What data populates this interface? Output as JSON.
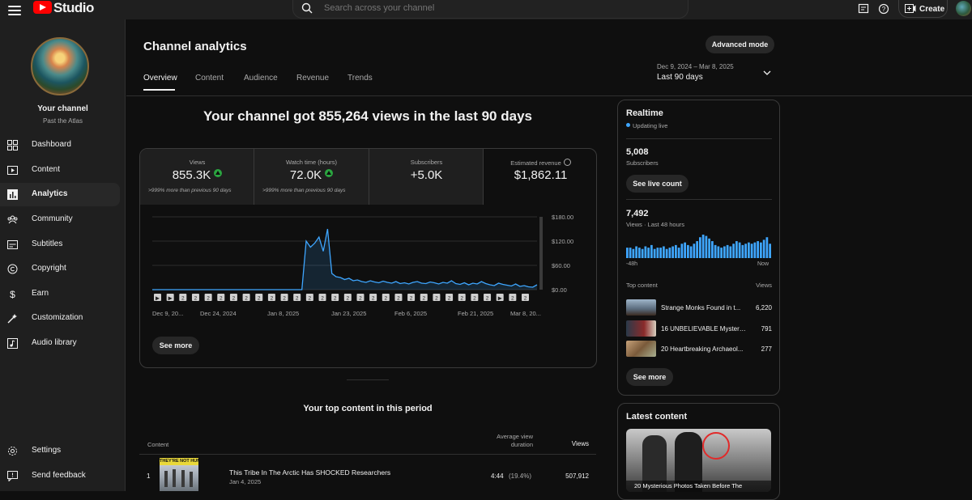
{
  "header": {
    "logo_text": "Studio",
    "search_placeholder": "Search across your channel",
    "create_label": "Create"
  },
  "sidebar": {
    "channel_title": "Your channel",
    "channel_name": "Past the Atlas",
    "items": [
      {
        "label": "Dashboard",
        "icon": "dashboard-icon"
      },
      {
        "label": "Content",
        "icon": "content-icon"
      },
      {
        "label": "Analytics",
        "icon": "analytics-icon",
        "active": true
      },
      {
        "label": "Community",
        "icon": "community-icon"
      },
      {
        "label": "Subtitles",
        "icon": "subtitles-icon"
      },
      {
        "label": "Copyright",
        "icon": "copyright-icon"
      },
      {
        "label": "Earn",
        "icon": "earn-icon"
      },
      {
        "label": "Customization",
        "icon": "customization-icon"
      },
      {
        "label": "Audio library",
        "icon": "audio-library-icon"
      }
    ],
    "bottom_items": [
      {
        "label": "Settings",
        "icon": "settings-icon"
      },
      {
        "label": "Send feedback",
        "icon": "feedback-icon"
      }
    ]
  },
  "main": {
    "title": "Channel analytics",
    "advanced_mode_label": "Advanced mode",
    "date_range": "Dec 9, 2024 – Mar 8, 2025",
    "date_label": "Last 90 days",
    "tabs": [
      "Overview",
      "Content",
      "Audience",
      "Revenue",
      "Trends"
    ],
    "active_tab": "Overview",
    "headline": "Your channel got 855,264 views in the last 90 days",
    "metrics": [
      {
        "label": "Views",
        "value": "855.3K",
        "note": ">999% more than previous 90 days",
        "trend": "up"
      },
      {
        "label": "Watch time (hours)",
        "value": "72.0K",
        "note": ">999% more than previous 90 days",
        "trend": "up"
      },
      {
        "label": "Subscribers",
        "value": "+5.0K"
      },
      {
        "label": "Estimated revenue",
        "value": "$1,862.11"
      }
    ],
    "see_more_label": "See more",
    "top_content_title": "Your top content in this period",
    "table": {
      "col_content": "Content",
      "col_avg_line1": "Average view",
      "col_avg_line2": "duration",
      "col_views": "Views",
      "rows": [
        {
          "rank": "1",
          "thumb_text": "THEY'RE NOT HUMAN",
          "title": "This Tribe In The Arctic Has SHOCKED Researchers",
          "date": "Jan 4, 2025",
          "avg_duration": "4:44",
          "avg_pct": "(19.4%)",
          "views": "507,912"
        }
      ]
    }
  },
  "chart_data": {
    "type": "area",
    "ylabel_ticks": [
      "$180.00",
      "$120.00",
      "$60.00",
      "$0.00"
    ],
    "ylim": [
      0,
      180
    ],
    "x_tick_labels": [
      "Dec 9, 20...",
      "Dec 24, 2024",
      "Jan 8, 2025",
      "Jan 23, 2025",
      "Feb 6, 2025",
      "Feb 21, 2025",
      "Mar 8, 20..."
    ],
    "series": [
      {
        "values": [
          0,
          0,
          0,
          0,
          0,
          0,
          0,
          0,
          0,
          0,
          0,
          0,
          0,
          0,
          0,
          0,
          0,
          0,
          0,
          0,
          0,
          0,
          0,
          0,
          0,
          0,
          0,
          0,
          0,
          0,
          0,
          0,
          0,
          0,
          0,
          0,
          120,
          105,
          115,
          130,
          95,
          150,
          40,
          32,
          30,
          25,
          28,
          22,
          24,
          20,
          18,
          22,
          19,
          17,
          21,
          18,
          16,
          20,
          15,
          17,
          14,
          18,
          20,
          16,
          15,
          19,
          17,
          14,
          18,
          16,
          22,
          15,
          13,
          17,
          12,
          16,
          14,
          20,
          15,
          12,
          10,
          16,
          13,
          11,
          9,
          14,
          8,
          10,
          7,
          6,
          12
        ]
      }
    ],
    "grid": true,
    "marker_glyphs": [
      "▶",
      "▶",
      "2",
      "2",
      "2",
      "2",
      "2",
      "2",
      "2",
      "2",
      "2",
      "2",
      "2",
      "2",
      "2",
      "2",
      "2",
      "2",
      "2",
      "2",
      "2",
      "2",
      "2",
      "2",
      "2",
      "2",
      "2",
      "▶",
      "2",
      "2"
    ],
    "selected_metric": "Estimated revenue"
  },
  "realtime": {
    "title": "Realtime",
    "status": "Updating live",
    "subscribers_value": "5,008",
    "subscribers_label": "Subscribers",
    "see_live_label": "See live count",
    "views_value": "7,492",
    "views_label": "Views · Last 48 hours",
    "axis_left": "-48h",
    "axis_right": "Now",
    "bars": [
      8,
      8,
      7,
      9,
      8,
      7,
      9,
      8,
      10,
      7,
      8,
      8,
      9,
      7,
      8,
      9,
      10,
      8,
      11,
      12,
      10,
      9,
      11,
      13,
      16,
      18,
      17,
      15,
      13,
      10,
      9,
      8,
      9,
      10,
      9,
      11,
      13,
      12,
      10,
      11,
      12,
      11,
      12,
      13,
      12,
      14,
      16,
      11
    ],
    "top_content_label": "Top content",
    "top_views_label": "Views",
    "items": [
      {
        "title": "Strange Monks Found in t...",
        "views": "6,220"
      },
      {
        "title": "16 UNBELIEVABLE Mysteri...",
        "views": "791"
      },
      {
        "title": "20 Heartbreaking Archaeol...",
        "views": "277"
      }
    ],
    "see_more_label": "See more"
  },
  "latest": {
    "title": "Latest content",
    "video_title": "20 Mysterious Photos Taken Before The"
  },
  "colors": {
    "background": "#0f0f0f",
    "surface": "#1f1f1f",
    "accent_chart": "#3ea6ff",
    "brand": "#ff0000",
    "positive": "#2ba640"
  }
}
